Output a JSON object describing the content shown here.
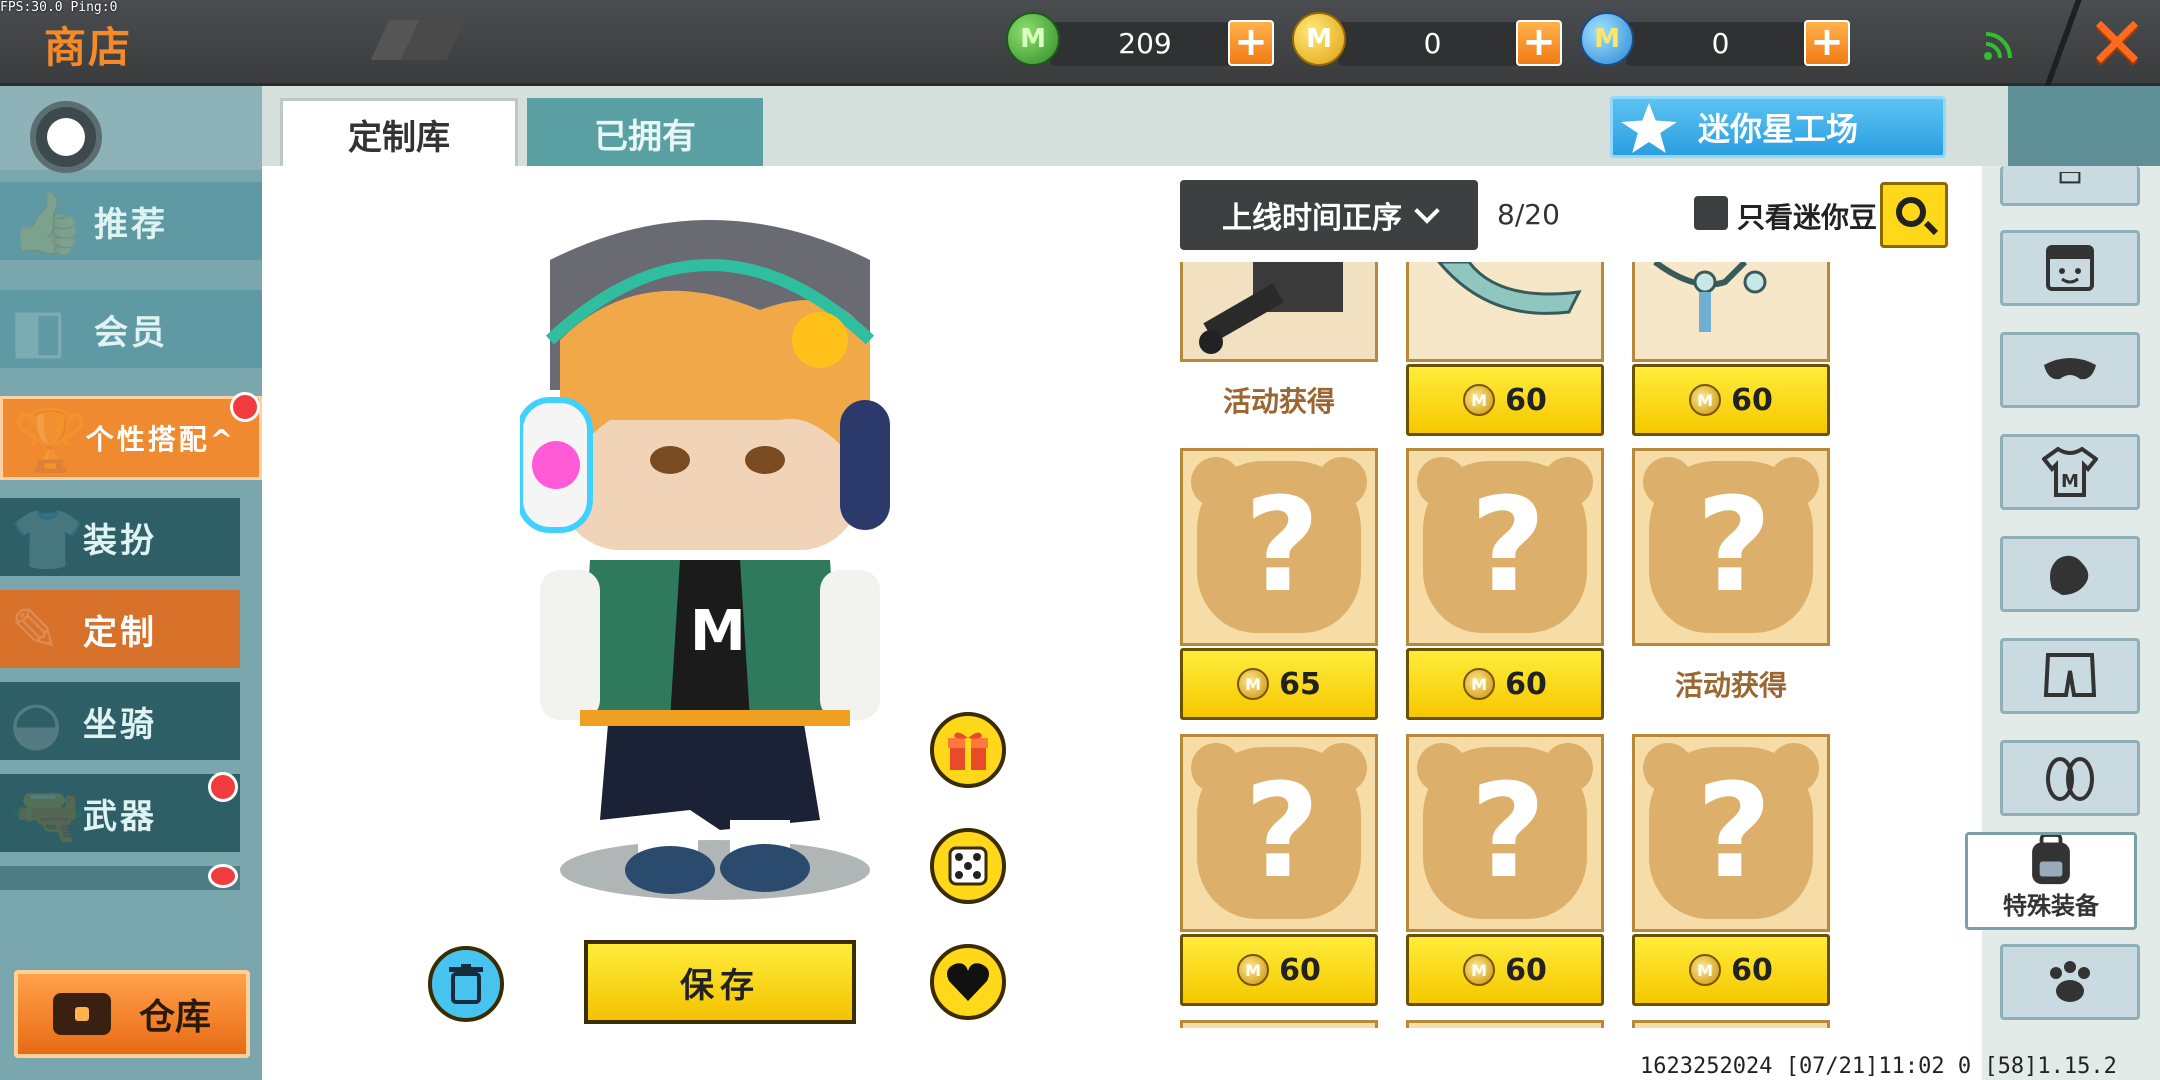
{
  "debug": {
    "fps_text": "FPS:30.0  Ping:0"
  },
  "header": {
    "title": "商店",
    "currencies": [
      {
        "icon": "mini-bean-green-coin-icon",
        "value": "209"
      },
      {
        "icon": "mini-coin-gold-icon",
        "value": "0"
      },
      {
        "icon": "mini-point-blue-coin-icon",
        "value": "0"
      }
    ],
    "add_label": "+",
    "close_label": "✕"
  },
  "sidebar": {
    "items": [
      {
        "label": "推荐",
        "icon": "thumbs-up-icon"
      },
      {
        "label": "会员",
        "icon": "vip-badge-icon"
      },
      {
        "label": "个性搭配^",
        "icon": "trophy-icon"
      },
      {
        "label": "装扮",
        "icon": "shirt-icon"
      },
      {
        "label": "定制",
        "icon": "pencil-icon"
      },
      {
        "label": "坐骑",
        "icon": "saddle-icon"
      },
      {
        "label": "武器",
        "icon": "gun-icon"
      }
    ],
    "warehouse_label": "仓库"
  },
  "tabs": [
    {
      "label": "定制库",
      "active": true
    },
    {
      "label": "已拥有",
      "active": false
    }
  ],
  "mini_factory_label": "迷你星工场",
  "toolbar": {
    "sort_label": "上线时间正序",
    "page_count": "8/20",
    "filter_label": "只看迷你豆",
    "filter_checked": false
  },
  "items": [
    {
      "price": null,
      "status": "活动获得",
      "image": "gatling-gun"
    },
    {
      "price": "60",
      "status": null,
      "image": "weapon-partial"
    },
    {
      "price": "60",
      "status": null,
      "image": "weapon-partial"
    },
    {
      "price": "65",
      "status": null,
      "image": "mystery"
    },
    {
      "price": "60",
      "status": null,
      "image": "mystery"
    },
    {
      "price": null,
      "status": "活动获得",
      "image": "mystery"
    },
    {
      "price": "60",
      "status": null,
      "image": "mystery"
    },
    {
      "price": "60",
      "status": null,
      "image": "mystery"
    },
    {
      "price": "60",
      "status": null,
      "image": "mystery"
    }
  ],
  "categories": [
    "hat",
    "face",
    "mask",
    "shirt",
    "gloves",
    "pants",
    "shoes",
    "special-equipment",
    "pet"
  ],
  "special_equipment_label": "特殊装备",
  "avatar_actions": {
    "save_label": "保存",
    "icons": [
      "trash-icon",
      "gift-box-icon",
      "dice-icon",
      "heart-icon"
    ]
  },
  "footer": {
    "info": "1623252024  [07/21]11:02 0  [58]1.15.2"
  },
  "colors": {
    "accent_orange": "#f08a30",
    "price_yellow": "#f6c800",
    "teal": "#5aa0a2",
    "dark_bar": "#3a3c3e"
  }
}
